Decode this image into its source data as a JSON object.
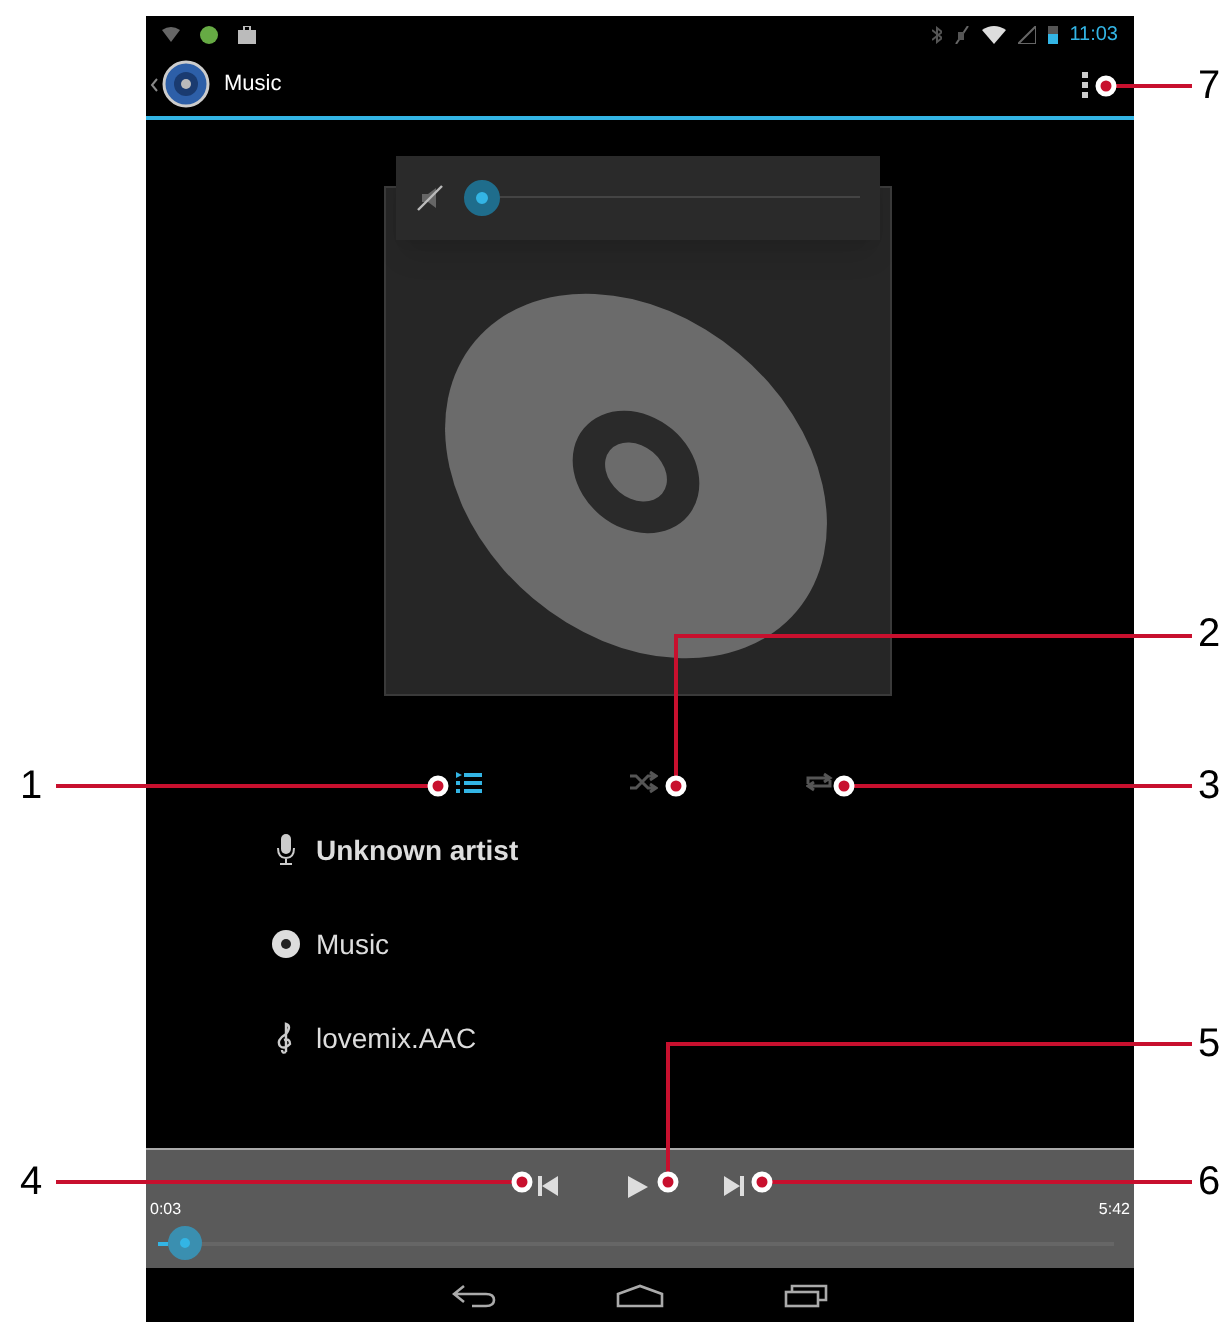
{
  "status_bar": {
    "time": "11:03"
  },
  "app_bar": {
    "title": "Music"
  },
  "volume_popup": {
    "muted": true,
    "level": 0
  },
  "controls": [
    {
      "kind": "queue",
      "selected": true
    },
    {
      "kind": "shuffle",
      "selected": false
    },
    {
      "kind": "repeat",
      "selected": false
    }
  ],
  "track_info": [
    {
      "kind": "artist",
      "text": "Unknown artist"
    },
    {
      "kind": "album",
      "text": "Music"
    },
    {
      "kind": "track",
      "text": "lovemix.AAC"
    }
  ],
  "playback": {
    "playing": false,
    "elapsed": "0:03",
    "duration": "5:42",
    "level": 0.01
  },
  "callouts": [
    {
      "label": "1"
    },
    {
      "label": "4"
    },
    {
      "label": "7"
    },
    {
      "label": "2"
    },
    {
      "label": "3"
    },
    {
      "label": "5"
    },
    {
      "label": "6"
    }
  ]
}
